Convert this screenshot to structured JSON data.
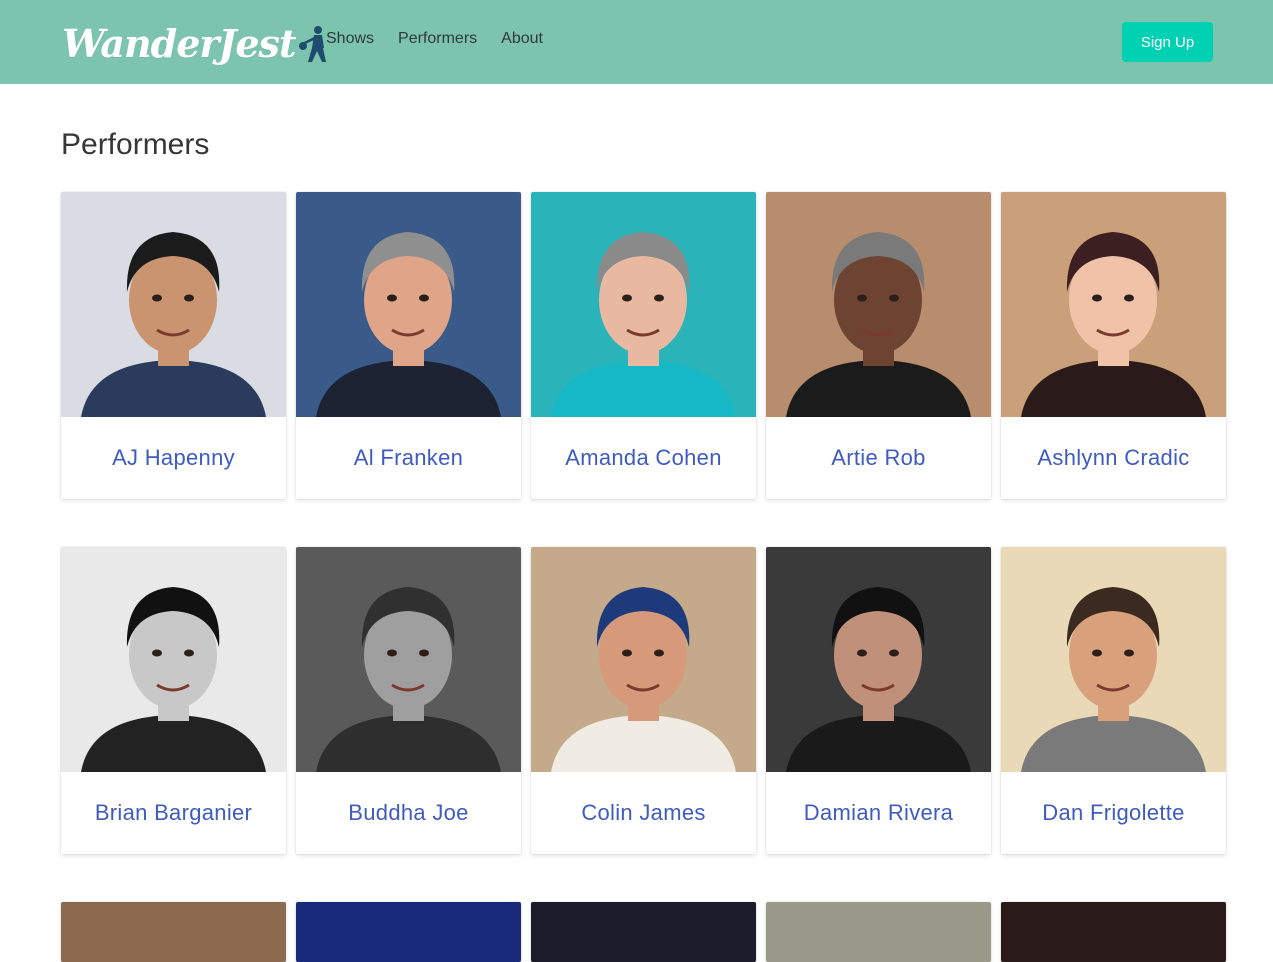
{
  "nav": {
    "logo_text": "WanderJest",
    "links": [
      {
        "label": "Shows"
      },
      {
        "label": "Performers"
      },
      {
        "label": "About"
      }
    ],
    "signup_label": "Sign Up"
  },
  "main": {
    "title": "Performers",
    "performers": [
      {
        "name": "AJ Hapenny",
        "bg": "#d9dde3",
        "skin": "#c9946f",
        "hair": "#1b1b1b",
        "shirt": "#2a3b5c"
      },
      {
        "name": "Al Franken",
        "bg": "#3a5b8a",
        "skin": "#e0a488",
        "hair": "#8f8f8f",
        "shirt": "#1d2333"
      },
      {
        "name": "Amanda Cohen",
        "bg": "#2ab3b8",
        "skin": "#e8b9a0",
        "hair": "#8a8a8a",
        "shirt": "#16b8c6"
      },
      {
        "name": "Artie Rob",
        "bg": "#b88d6e",
        "skin": "#6d4432",
        "hair": "#7a7a7a",
        "shirt": "#1b1b1b"
      },
      {
        "name": "Ashlynn Cradic",
        "bg": "#c9a07a",
        "skin": "#f0c3a8",
        "hair": "#3c1f20",
        "shirt": "#2b1a1a"
      },
      {
        "name": "Brian Barganier",
        "bg": "#e9e9e9",
        "skin": "#c8c8c8",
        "hair": "#111111",
        "shirt": "#222222"
      },
      {
        "name": "Buddha Joe",
        "bg": "#5a5a5a",
        "skin": "#9f9f9f",
        "hair": "#303030",
        "shirt": "#2e2e2e"
      },
      {
        "name": "Colin James",
        "bg": "#c4a98a",
        "skin": "#d69a7a",
        "hair": "#1f3a7a",
        "shirt": "#f0ece4"
      },
      {
        "name": "Damian Rivera",
        "bg": "#3a3a3a",
        "skin": "#c0907a",
        "hair": "#111111",
        "shirt": "#1a1a1a"
      },
      {
        "name": "Dan Frigolette",
        "bg": "#e9d9b6",
        "skin": "#d9a07c",
        "hair": "#3a2a20",
        "shirt": "#7a7a7a"
      }
    ]
  }
}
